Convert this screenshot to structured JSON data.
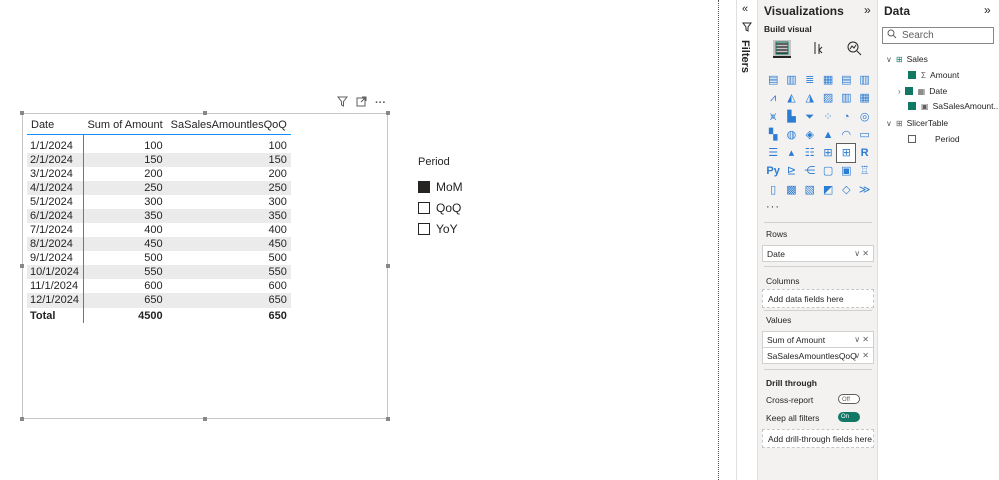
{
  "table": {
    "headers": [
      "Date",
      "Sum of Amount",
      "SaSalesAmountlesQoQ"
    ],
    "rows": [
      [
        "1/1/2024",
        "100",
        "100"
      ],
      [
        "2/1/2024",
        "150",
        "150"
      ],
      [
        "3/1/2024",
        "200",
        "200"
      ],
      [
        "4/1/2024",
        "250",
        "250"
      ],
      [
        "5/1/2024",
        "300",
        "300"
      ],
      [
        "6/1/2024",
        "350",
        "350"
      ],
      [
        "7/1/2024",
        "400",
        "400"
      ],
      [
        "8/1/2024",
        "450",
        "450"
      ],
      [
        "9/1/2024",
        "500",
        "500"
      ],
      [
        "10/1/2024",
        "550",
        "550"
      ],
      [
        "11/1/2024",
        "600",
        "600"
      ],
      [
        "12/1/2024",
        "650",
        "650"
      ]
    ],
    "total": [
      "Total",
      "4500",
      "650"
    ]
  },
  "slicer": {
    "title": "Period",
    "items": [
      {
        "label": "MoM",
        "checked": true
      },
      {
        "label": "QoQ",
        "checked": false
      },
      {
        "label": "YoY",
        "checked": false
      }
    ]
  },
  "filters": {
    "label": "Filters"
  },
  "visualizations": {
    "title": "Visualizations",
    "build_visual": "Build visual",
    "more": "···",
    "rows_label": "Rows",
    "rows_field": "Date",
    "columns_label": "Columns",
    "columns_placeholder": "Add data fields here",
    "values_label": "Values",
    "values_fields": [
      "Sum of Amount",
      "SaSalesAmountlesQoQ"
    ],
    "drill_title": "Drill through",
    "cross_report": "Cross-report",
    "cross_report_toggle": "Off",
    "keep_filters": "Keep all filters",
    "keep_filters_toggle": "On",
    "drill_placeholder": "Add drill-through fields here"
  },
  "data_pane": {
    "title": "Data",
    "search_placeholder": "Search",
    "tables": [
      {
        "name": "Sales",
        "fields": [
          {
            "name": "Amount",
            "type": "sigma",
            "checked": true
          },
          {
            "name": "Date",
            "type": "calendar",
            "checked": true
          },
          {
            "name": "SaSalesAmount...",
            "type": "calc",
            "checked": true
          }
        ]
      },
      {
        "name": "SlicerTable",
        "fields": [
          {
            "name": "Period",
            "type": "text",
            "checked": false
          }
        ]
      }
    ]
  },
  "colors": {
    "accent": "#118dff",
    "toggle_on": "#117865",
    "pane_bg": "#f3f2f1"
  }
}
